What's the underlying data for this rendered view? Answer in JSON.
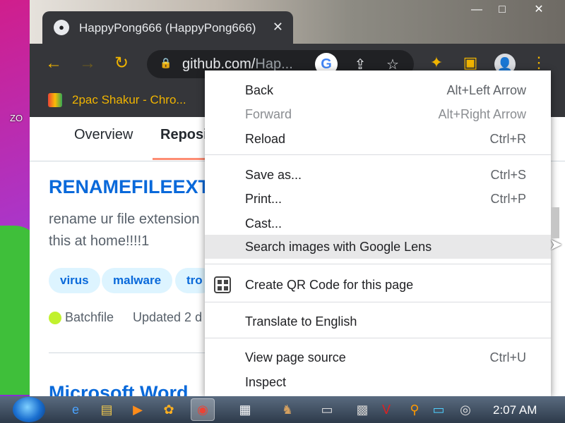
{
  "desktop": {
    "side_label": "ZO"
  },
  "browser": {
    "tab": {
      "title": "HappyPong666 (HappyPong666)",
      "close_glyph": "✕"
    },
    "window_controls": {
      "minimize": "—",
      "maximize": "□",
      "close": "✕"
    },
    "url": {
      "host": "github.com/",
      "path": "Hap..."
    },
    "bookmark": {
      "label": "2pac Shakur - Chro..."
    }
  },
  "page": {
    "tabs": [
      {
        "label": "Overview"
      },
      {
        "label": "Reposi"
      }
    ],
    "repo": {
      "name": "RENAMEFILEEXT",
      "description": "rename ur file extension this at home!!!!1",
      "topics": [
        "virus",
        "malware",
        "tro"
      ],
      "language": "Batchfile",
      "updated": "Updated 2 d"
    },
    "next_repo_name": "Microsoft Word"
  },
  "context_menu": {
    "items": [
      {
        "label": "Back",
        "shortcut": "Alt+Left Arrow"
      },
      {
        "label": "Forward",
        "shortcut": "Alt+Right Arrow",
        "disabled": true
      },
      {
        "label": "Reload",
        "shortcut": "Ctrl+R"
      },
      {
        "label": "Save as...",
        "shortcut": "Ctrl+S"
      },
      {
        "label": "Print...",
        "shortcut": "Ctrl+P"
      },
      {
        "label": "Cast...",
        "shortcut": ""
      },
      {
        "label": "Search images with Google Lens",
        "shortcut": "",
        "hovered": true
      },
      {
        "label": "Create QR Code for this page",
        "shortcut": "",
        "icon": "qr-code-icon"
      },
      {
        "label": "Translate to English",
        "shortcut": ""
      },
      {
        "label": "View page source",
        "shortcut": "Ctrl+U"
      },
      {
        "label": "Inspect",
        "shortcut": ""
      }
    ]
  },
  "taskbar": {
    "clock": "2:07 AM"
  },
  "colors": {
    "accent_link": "#0969da",
    "chrome_dark": "#35363a",
    "toolbar_icon": "#f0b400"
  }
}
